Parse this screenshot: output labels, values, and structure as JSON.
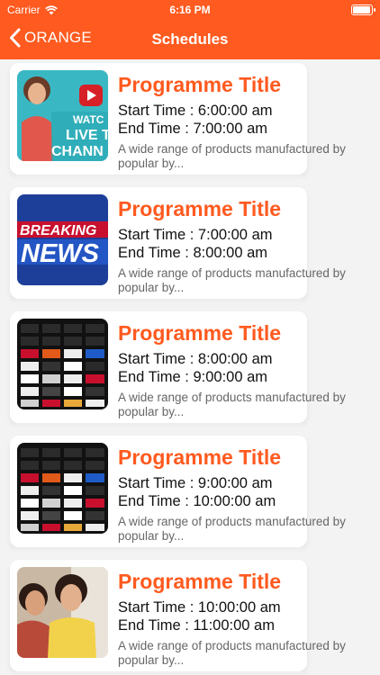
{
  "status_bar": {
    "carrier": "Carrier",
    "time": "6:16 PM",
    "battery_level": 1.0
  },
  "nav": {
    "back_label": "ORANGE",
    "title": "Schedules"
  },
  "colors": {
    "accent": "#ff5a1f",
    "background": "#f3f3f3"
  },
  "schedules": [
    {
      "title": "Programme Title",
      "start": "Start Time : 6:00:00 am",
      "end": "End Time : 7:00:00 am",
      "description": "A wide range of products manufactured by popular by...",
      "thumb_text": [
        "WATC",
        "LIVE T",
        "CHANN"
      ]
    },
    {
      "title": "Programme Title",
      "start": "Start Time : 7:00:00 am",
      "end": "End Time : 8:00:00 am",
      "description": "A wide range of products manufactured by popular by...",
      "thumb_text": [
        "BREAKING",
        "NEWS"
      ]
    },
    {
      "title": "Programme Title",
      "start": "Start Time : 8:00:00 am",
      "end": "End Time : 9:00:00 am",
      "description": "A wide range of products manufactured by popular by..."
    },
    {
      "title": "Programme Title",
      "start": "Start Time : 9:00:00 am",
      "end": "End Time : 10:00:00 am",
      "description": "A wide range of products manufactured by popular by..."
    },
    {
      "title": "Programme Title",
      "start": "Start Time : 10:00:00 am",
      "end": "End Time : 11:00:00 am",
      "description": "A wide range of products manufactured by popular by..."
    }
  ]
}
